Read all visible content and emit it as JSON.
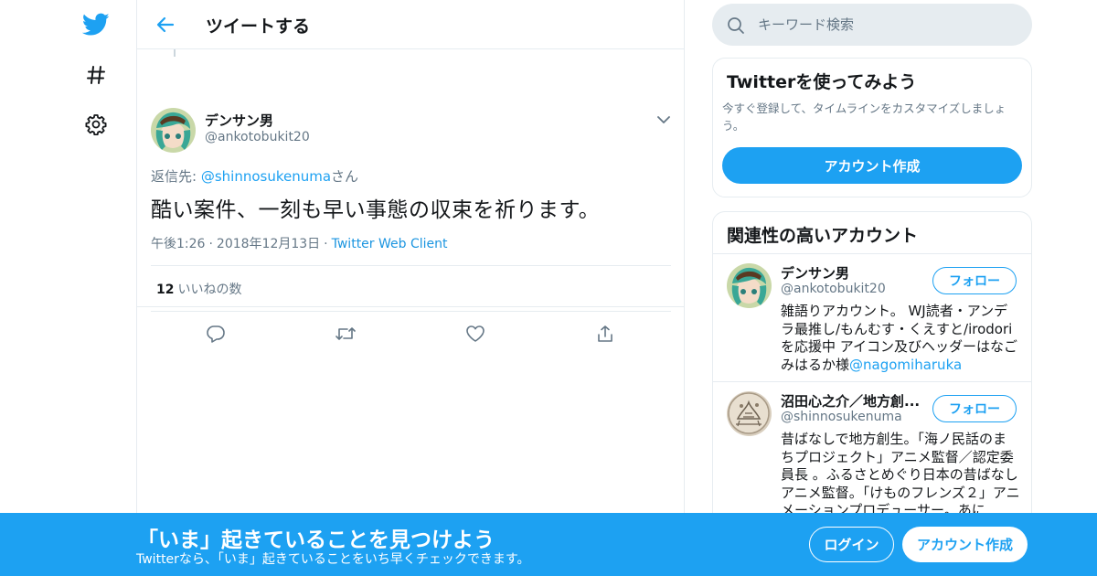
{
  "colors": {
    "brand": "#1da1f2",
    "text_primary": "#14171a",
    "text_secondary": "#657786",
    "border": "#e6ecf0"
  },
  "nav": {
    "items": [
      {
        "icon": "twitter-bird-icon"
      },
      {
        "icon": "hashtag-icon"
      },
      {
        "icon": "gear-icon"
      }
    ]
  },
  "header": {
    "back_icon": "arrow-left-icon",
    "title": "ツイートする"
  },
  "tweet": {
    "author_name": "デンサン男",
    "author_handle": "@ankotobukit20",
    "reply_prefix": "返信先: ",
    "reply_handle": "@shinnosukenuma",
    "reply_suffix": "さん",
    "text": "酷い案件、一刻も早い事態の収束を祈ります。",
    "time": "午後1:26",
    "date": "2018年12月13日",
    "source": "Twitter Web Client",
    "likes_count": "12",
    "likes_label": "いいねの数",
    "actions": [
      "reply-icon",
      "retweet-icon",
      "like-icon",
      "share-icon"
    ]
  },
  "search": {
    "placeholder": "キーワード検索"
  },
  "signup_card": {
    "title": "Twitterを使ってみよう",
    "description": "今すぐ登録して、タイムラインをカスタマイズしましょう。",
    "button": "アカウント作成"
  },
  "related": {
    "title": "関連性の高いアカウント",
    "follow_label": "フォロー",
    "accounts": [
      {
        "name": "デンサン男",
        "handle": "@ankotobukit20",
        "bio": "雑語りアカウント。 WJ読者・アンデラ最推し/もんむす・くえすと/irodoriを応援中 アイコン及びヘッダーはなごみはるか様",
        "bio_link": "@nagomiharuka"
      },
      {
        "name": "沼田心之介／地方創...",
        "handle": "@shinnosukenuma",
        "bio": "昔ばなしで地方創生。「海ノ民話のまちプロジェクト」アニメ監督／認定委員長 。ふるさとめぐり日本の昔ばなしアニメ監督。「けものフレンズ２」アニメーションプロデューサー。あに",
        "bio_link": ""
      }
    ]
  },
  "banner": {
    "headline": "「いま」起きていることを見つけよう",
    "subtext": "Twitterなら、「いま」起きていることをいち早くチェックできます。",
    "login": "ログイン",
    "signup": "アカウント作成"
  }
}
